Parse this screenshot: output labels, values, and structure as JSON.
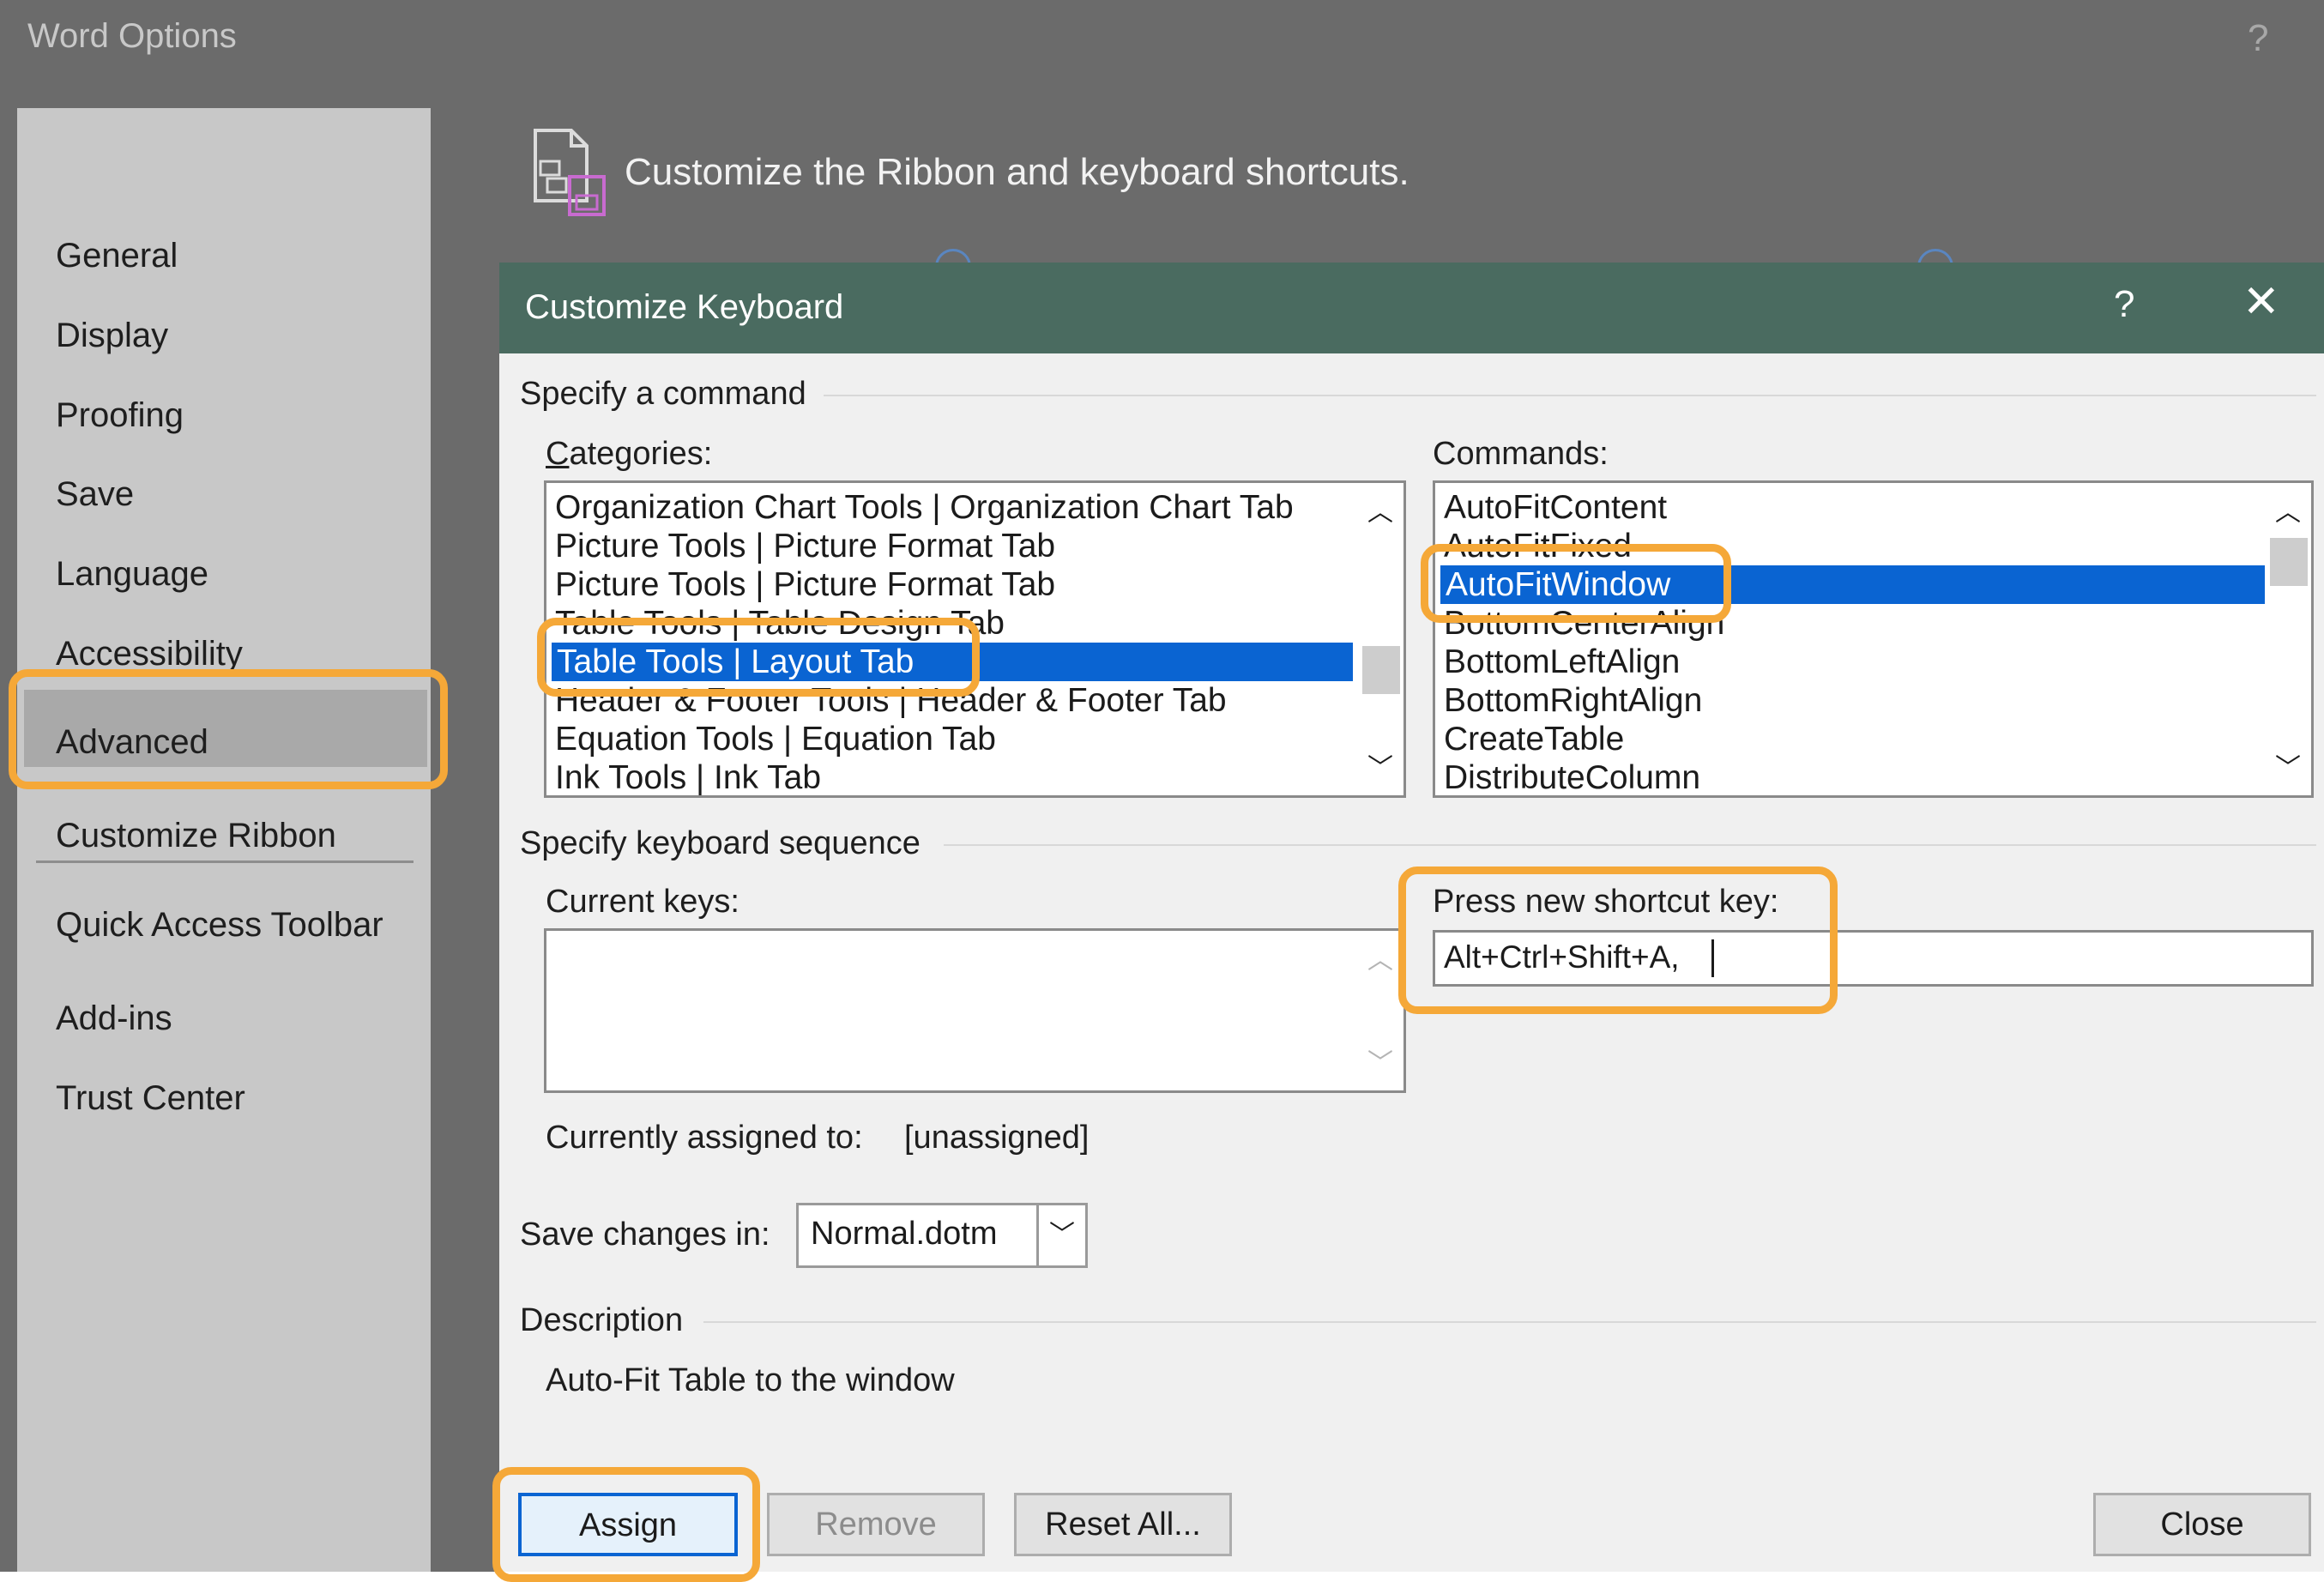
{
  "options_window": {
    "title": "Word Options",
    "help": "?",
    "nav_items": [
      "General",
      "Display",
      "Proofing",
      "Save",
      "Language",
      "Accessibility",
      "Advanced",
      "Customize Ribbon",
      "Quick Access Toolbar",
      "Add-ins",
      "Trust Center"
    ],
    "selected_nav": "Customize Ribbon",
    "header_text": "Customize the Ribbon and keyboard shortcuts."
  },
  "dialog": {
    "title": "Customize Keyboard",
    "help": "?",
    "close": "✕",
    "specify_command": "Specify a command",
    "categories_label": "Categories:",
    "categories": [
      "Organization Chart Tools | Organization Chart Tab",
      "Picture Tools | Picture Format Tab",
      "Picture Tools | Picture Format Tab",
      "Table Tools | Table Design Tab",
      "Table Tools | Layout Tab",
      "Header & Footer Tools | Header & Footer Tab",
      "Equation Tools | Equation Tab",
      "Ink Tools | Ink Tab"
    ],
    "selected_category": "Table Tools | Layout Tab",
    "commands_label": "Commands:",
    "commands": [
      "AutoFitContent",
      "AutoFitFixed",
      "AutoFitWindow",
      "BottomCenterAlign",
      "BottomLeftAlign",
      "BottomRightAlign",
      "CreateTable",
      "DistributeColumn"
    ],
    "selected_command": "AutoFitWindow",
    "specify_sequence": "Specify keyboard sequence",
    "current_keys_label": "Current keys:",
    "press_new_label": "Press new shortcut key:",
    "new_shortcut_value": "Alt+Ctrl+Shift+A,",
    "currently_assigned_label": "Currently assigned to:",
    "currently_assigned_value": "[unassigned]",
    "save_changes_label": "Save changes in:",
    "save_changes_value": "Normal.dotm",
    "description_label": "Description",
    "description_text": "Auto-Fit Table to the window",
    "buttons": {
      "assign": "Assign",
      "remove": "Remove",
      "reset_all": "Reset All...",
      "close": "Close"
    }
  },
  "colors": {
    "selection": "#0a64d2",
    "highlight_outline": "#f5a838",
    "dialog_titlebar": "#4a6b60"
  }
}
